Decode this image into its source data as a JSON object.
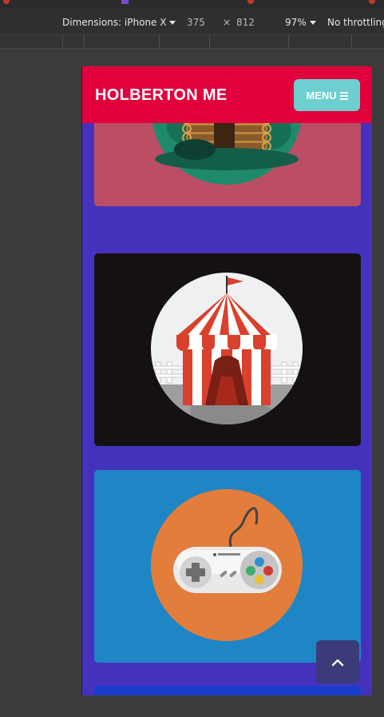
{
  "devtools": {
    "device_label": "Dimensions: iPhone X",
    "width": "375",
    "times": "×",
    "height": "812",
    "zoom": "97%",
    "throttling": "No throttling"
  },
  "site": {
    "brand": "HOLBERTON ME",
    "menu_label": "MENU"
  },
  "cards": [
    {
      "name": "cabin-card",
      "icon": "log-cabin-icon",
      "color": "#bb4e65"
    },
    {
      "name": "circus-card",
      "icon": "circus-tent-icon",
      "color": "#141110"
    },
    {
      "name": "gamepad-card",
      "icon": "game-controller-icon",
      "color": "#1f86c6"
    },
    {
      "name": "partial-card",
      "icon": "",
      "color": "#1a3dcc"
    }
  ],
  "colors": {
    "header": "#e1003c",
    "menu_button": "#6dcfcf",
    "page_background": "#4532bc"
  }
}
